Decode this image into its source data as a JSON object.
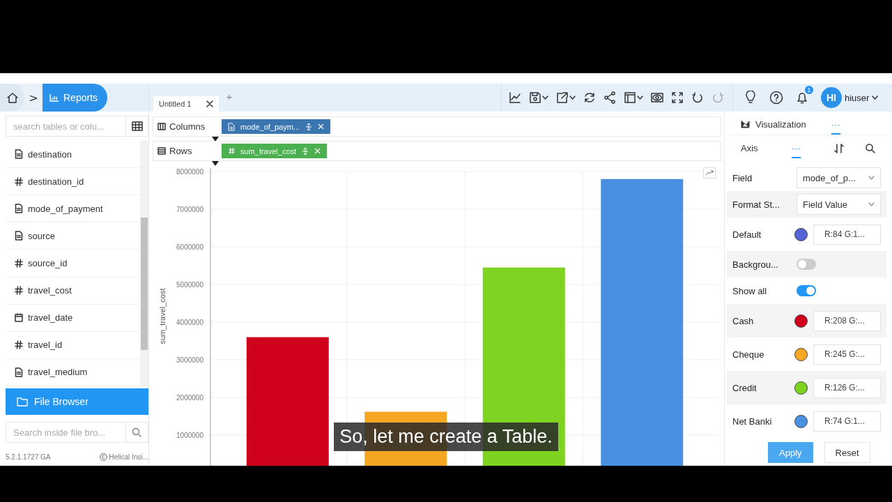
{
  "header": {
    "breadcrumb": ">",
    "section": "Reports",
    "tabs": [
      {
        "label": "Untitled 1",
        "selected": true
      }
    ],
    "add_tab": "+",
    "notification_count": "1",
    "user": {
      "initials": "HI",
      "name": "hiuser"
    }
  },
  "left_panel": {
    "search_placeholder": "search tables or colu...",
    "columns": [
      {
        "name": "destination",
        "kind": "text"
      },
      {
        "name": "destination_id",
        "kind": "number"
      },
      {
        "name": "mode_of_payment",
        "kind": "text"
      },
      {
        "name": "source",
        "kind": "text"
      },
      {
        "name": "source_id",
        "kind": "number"
      },
      {
        "name": "travel_cost",
        "kind": "number"
      },
      {
        "name": "travel_date",
        "kind": "date"
      },
      {
        "name": "travel_id",
        "kind": "number"
      },
      {
        "name": "travel_medium",
        "kind": "text"
      }
    ],
    "file_browser": "File Browser",
    "file_search_placeholder": "Search inside file bro...",
    "version": "5.2.1.1727 GA",
    "copyright": "Helical Insi..."
  },
  "shelf": [
    {
      "label": "Columns",
      "kind": "columns",
      "pills": [
        {
          "label": "mode_of_paym...",
          "kind": "text"
        }
      ]
    },
    {
      "label": "Rows",
      "kind": "rows",
      "pills": [
        {
          "label": "sum_travel_cost",
          "kind": "number"
        }
      ]
    }
  ],
  "chart_data": {
    "type": "bar",
    "ylabel": "sum_travel_cost",
    "values": [
      3600000,
      1620000,
      5450000,
      7800000
    ],
    "ylim": [
      0,
      8000000
    ],
    "grid": true,
    "yticks": [
      1000000,
      2000000,
      3000000,
      4000000,
      5000000,
      6000000,
      7000000,
      8000000
    ]
  },
  "settings": {
    "tabs": [
      {
        "label": "Visualization",
        "selected": false
      },
      {
        "label": "···",
        "selected": true
      }
    ],
    "subtabs": [
      {
        "label": "Axis",
        "selected": false
      },
      {
        "label": "···",
        "selected": true
      }
    ],
    "rows": [
      {
        "kind": "select",
        "label": "Field",
        "value": "mode_of_p..."
      },
      {
        "kind": "select",
        "label": "Format St...",
        "value": "Field Value"
      },
      {
        "kind": "color",
        "label": "Default",
        "color": "#5463d8",
        "value": "R:84 G:1..."
      },
      {
        "kind": "toggle",
        "label": "Backgrou...",
        "on": false
      },
      {
        "kind": "toggle",
        "label": "Show all",
        "on": true
      },
      {
        "kind": "color",
        "label": "Cash",
        "color": "#d0021b",
        "value": "R:208 G:..."
      },
      {
        "kind": "color",
        "label": "Cheque",
        "color": "#f5a623",
        "value": "R:245 G:..."
      },
      {
        "kind": "color",
        "label": "Credit",
        "color": "#7ed321",
        "value": "R:126 G:..."
      },
      {
        "kind": "color",
        "label": "Net Banki",
        "color": "#4a90e2",
        "value": "R:74 G:1..."
      }
    ],
    "buttons": [
      {
        "label": "Apply",
        "kind": "primary"
      },
      {
        "label": "Reset",
        "kind": "secondary"
      }
    ]
  },
  "caption": "So, let me create a Table."
}
